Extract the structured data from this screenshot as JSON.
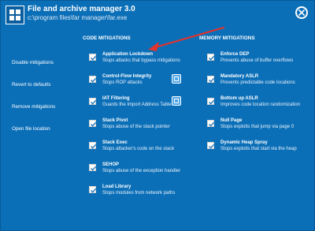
{
  "header": {
    "title": "File and archive manager 3.0",
    "path": "c:\\program files\\far manager\\far.exe"
  },
  "sidebar": {
    "items": [
      {
        "label": "Disable mitigations"
      },
      {
        "label": "Revert to defaults"
      },
      {
        "label": "Remove mitigations"
      },
      {
        "label": "Open file location"
      }
    ]
  },
  "code_mitigations": {
    "heading": "CODE MITIGATIONS",
    "items": [
      {
        "name": "Application Lockdown",
        "desc": "Stops attacks that bypass mitigations",
        "checked": true,
        "badge": false
      },
      {
        "name": "Control-Flow Integrity",
        "desc": "Stops ROP attacks",
        "checked": true,
        "badge": true
      },
      {
        "name": "IAT Filtering",
        "desc": "Guards the Import Address Table",
        "checked": true,
        "badge": true
      },
      {
        "name": "Stack Pivot",
        "desc": "Stops abuse of the stack pointer",
        "checked": true,
        "badge": false
      },
      {
        "name": "Stack Exec",
        "desc": "Stops attacker's code on the stack",
        "checked": true,
        "badge": false
      },
      {
        "name": "SEHOP",
        "desc": "Stops abuse of the exception handler",
        "checked": true,
        "badge": false
      },
      {
        "name": "Load Library",
        "desc": "Stops modules from network paths",
        "checked": true,
        "badge": false
      }
    ]
  },
  "memory_mitigations": {
    "heading": "MEMORY MITIGATIONS",
    "items": [
      {
        "name": "Enforce DEP",
        "desc": "Prevents abuse of buffer overflows",
        "checked": true
      },
      {
        "name": "Mandatory ASLR",
        "desc": "Prevents predictable code locations",
        "checked": true
      },
      {
        "name": "Bottom up ASLR",
        "desc": "Improves code location randomization",
        "checked": true
      },
      {
        "name": "Null Page",
        "desc": "Stops exploits that jump via page 0",
        "checked": true
      },
      {
        "name": "Dynamic Heap Spray",
        "desc": "Stops exploits that start via the heap",
        "checked": true
      }
    ]
  },
  "colors": {
    "background": "#0b6fb8",
    "arrow": "#e0332e",
    "check": "#1a6fb5"
  }
}
